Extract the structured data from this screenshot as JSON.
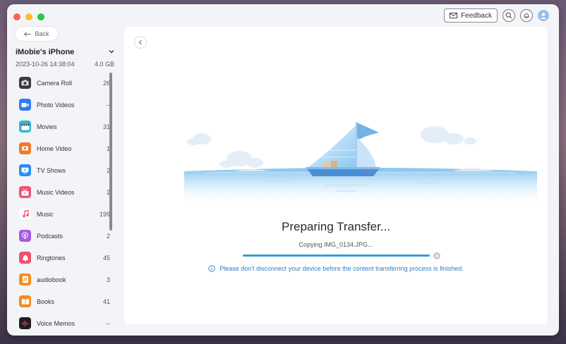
{
  "header": {
    "feedback_label": "Feedback"
  },
  "nav": {
    "back_label": "Back"
  },
  "device": {
    "name": "iMobie's iPhone",
    "date": "2023-10-26 14:38:04",
    "capacity": "4.0 GB"
  },
  "sidebar": {
    "items": [
      {
        "label": "Camera Roll",
        "count": "26",
        "icon": "camera-icon",
        "color": "#3a3a3c"
      },
      {
        "label": "Photo Videos",
        "count": "--",
        "icon": "video-camera-icon",
        "color": "#2f7df6"
      },
      {
        "label": "Movies",
        "count": "31",
        "icon": "clapperboard-icon",
        "color": "#2fb7d8"
      },
      {
        "label": "Home Video",
        "count": "1",
        "icon": "home-video-icon",
        "color": "#f07b26"
      },
      {
        "label": "TV Shows",
        "count": "2",
        "icon": "tv-icon",
        "color": "#2c8cf0"
      },
      {
        "label": "Music Videos",
        "count": "2",
        "icon": "music-video-icon",
        "color": "#f25473"
      },
      {
        "label": "Music",
        "count": "199",
        "icon": "music-note-icon",
        "color": "#ffffff"
      },
      {
        "label": "Podcasts",
        "count": "2",
        "icon": "podcast-icon",
        "color": "#a65ae6"
      },
      {
        "label": "Ringtones",
        "count": "45",
        "icon": "bell-icon",
        "color": "#f2506f"
      },
      {
        "label": "audiobook",
        "count": "3",
        "icon": "audiobook-icon",
        "color": "#f58b1f"
      },
      {
        "label": "Books",
        "count": "41",
        "icon": "book-icon",
        "color": "#f58b1f"
      },
      {
        "label": "Voice Memos",
        "count": "--",
        "icon": "waveform-icon",
        "color": "#1f1f22"
      }
    ]
  },
  "transfer": {
    "title": "Preparing Transfer...",
    "subtitle": "Copying IMG_0134.JPG...",
    "progress_percent": 100,
    "notice": "Please don't disconnect your device before the content transferring process is finished."
  },
  "colors": {
    "accent": "#3a9ad9",
    "notice": "#2f7fc4"
  }
}
